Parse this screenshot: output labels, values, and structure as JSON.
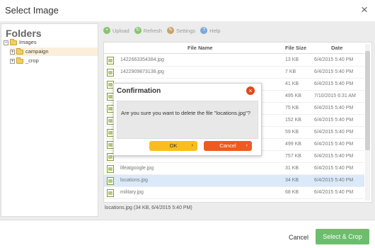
{
  "dialog": {
    "title": "Select Image",
    "close_glyph": "×"
  },
  "folders": {
    "heading": "Folders",
    "tree": [
      {
        "label": "Images",
        "toggle": "−"
      },
      {
        "label": "campaign",
        "toggle": "+"
      },
      {
        "label": "_crop",
        "toggle": "+"
      }
    ]
  },
  "toolbar": {
    "upload": "Upload",
    "refresh": "Refresh",
    "settings": "Settings",
    "help": "Help"
  },
  "files": {
    "columns": {
      "name": "File Name",
      "size": "File Size",
      "date": "Date"
    },
    "rows": [
      {
        "name": "1422663354384.jpg",
        "size": "13 KB",
        "date": "6/4/2015 5:40 PM"
      },
      {
        "name": "1422909873138.jpg",
        "size": "7 KB",
        "date": "6/4/2015 5:40 PM"
      },
      {
        "name": "",
        "size": "41 KB",
        "date": "6/4/2015 5:40 PM"
      },
      {
        "name": "",
        "size": "495 KB",
        "date": "7/10/2015 6:31 AM"
      },
      {
        "name": "",
        "size": "75 KB",
        "date": "6/4/2015 5:40 PM"
      },
      {
        "name": "",
        "size": "152 KB",
        "date": "6/4/2015 5:40 PM"
      },
      {
        "name": "",
        "size": "59 KB",
        "date": "6/4/2015 5:40 PM"
      },
      {
        "name": "",
        "size": "499 KB",
        "date": "6/4/2015 5:40 PM"
      },
      {
        "name": "",
        "size": "757 KB",
        "date": "6/4/2015 5:40 PM"
      },
      {
        "name": "lifeatgoogle.jpg",
        "size": "31 KB",
        "date": "6/4/2015 5:40 PM"
      },
      {
        "name": "locations.jpg",
        "size": "34 KB",
        "date": "6/4/2015 5:40 PM"
      },
      {
        "name": "military.jpg",
        "size": "68 KB",
        "date": "6/4/2015 5:40 PM"
      }
    ],
    "selected_index": 10
  },
  "status": "locations.jpg (34 KB, 6/4/2015 5:40 PM)",
  "footer": {
    "cancel": "Cancel",
    "primary": "Select & Crop"
  },
  "confirm": {
    "title": "Confirmation",
    "message": "Are you sure you want to delete the file \"locations.jpg\"?",
    "ok": "OK",
    "cancel": "Cancel",
    "close_glyph": "×",
    "arrow_glyph": "›"
  },
  "colors": {
    "primary": "#6dbd6e",
    "ok": "#fbbd1c",
    "cancel": "#ef5a20",
    "selected_row": "#dbe9f9"
  }
}
